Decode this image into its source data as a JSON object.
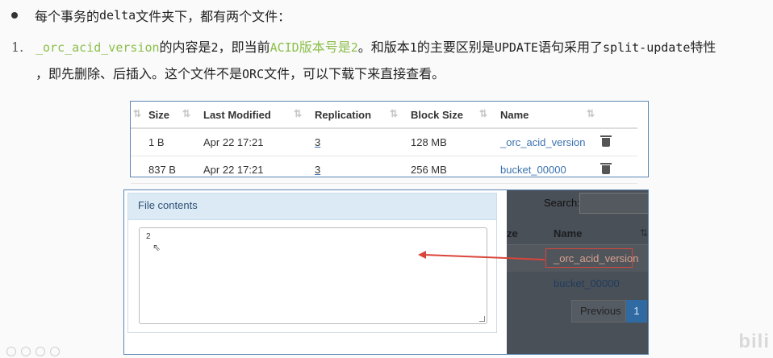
{
  "bullet": {
    "text_a": "每个事务的",
    "text_mono": "delta",
    "text_b": "文件夹下，都有两个文件："
  },
  "point1": {
    "index": "1.",
    "file": "_orc_acid_version",
    "text_a": "的内容是",
    "num2": "2",
    "text_b": "，即当前",
    "acid": "ACID",
    "text_c": "版本号是",
    "num2b": "2",
    "text_d": "。和版本",
    "num1": "1",
    "text_e": "的主要区别是",
    "update": "UPDATE",
    "text_f": "语句采用了",
    "split": "split-update",
    "text_g": "特性",
    "line2_a": "，即先删除、后插入。这个文件不是",
    "orc": "ORC",
    "line2_b": "文件，可以下载下来直接查看。"
  },
  "table": {
    "headers": [
      "Size",
      "Last Modified",
      "Replication",
      "Block Size",
      "Name"
    ],
    "rows": [
      {
        "size": "1 B",
        "modified": "Apr 22 17:21",
        "replication": "3",
        "block": "128 MB",
        "name": "_orc_acid_version"
      },
      {
        "size": "837 B",
        "modified": "Apr 22 17:21",
        "replication": "3",
        "block": "256 MB",
        "name": "bucket_00000"
      }
    ],
    "sort_glyph": "⇅"
  },
  "modal": {
    "title": "File contents",
    "content": "2"
  },
  "background": {
    "search_label": "Search:",
    "col_partial": "ze",
    "col_name": "Name",
    "row1_name": "_orc_acid_version",
    "row2_name": "bucket_00000",
    "prev_label": "Previous",
    "page": "1"
  },
  "watermark": "bili",
  "colors": {
    "accent_green": "#8bbf4a",
    "link_blue": "#3b73af",
    "highlight_red": "#d9453b"
  }
}
